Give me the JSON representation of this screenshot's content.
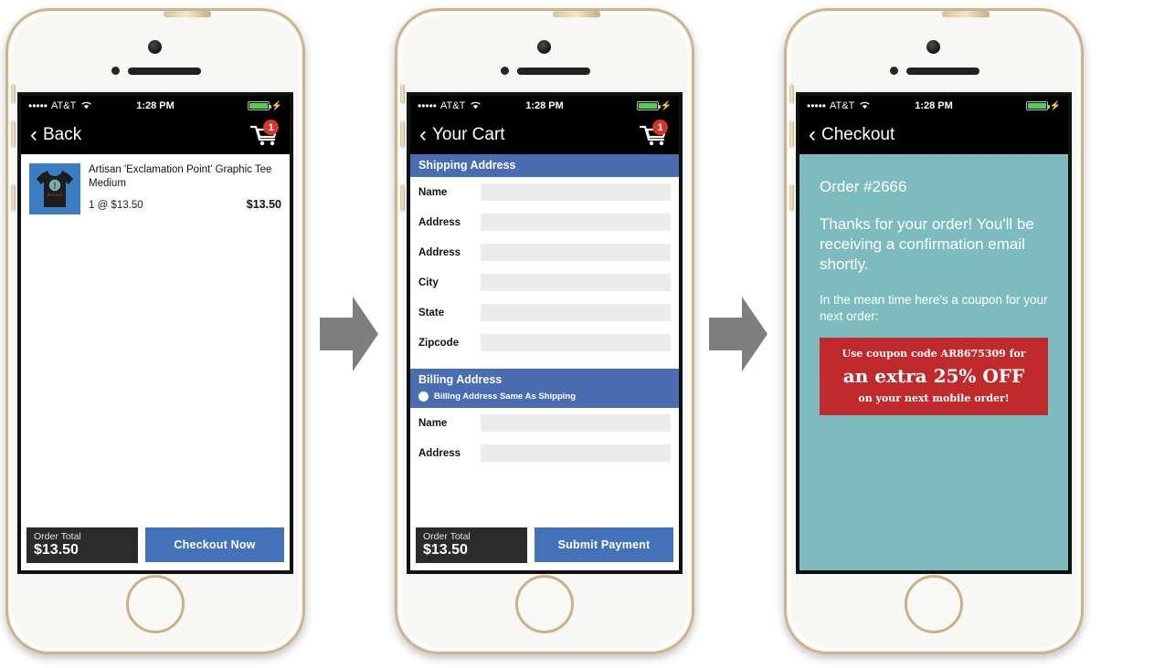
{
  "meta": {
    "screens": 3,
    "arrow_color": "#7f7f7f",
    "accent_blue": "#4a6cb0",
    "accent_teal": "#7cbcbf",
    "accent_red": "#c02a2c",
    "badge_red": "#d9342b"
  },
  "status_bar": {
    "signal_dots": "•••••",
    "carrier": "AT&T",
    "wifi_icon": "wifi-icon",
    "time": "1:28 PM",
    "battery_icon": "battery-icon",
    "charging_icon": "⚡"
  },
  "screen1": {
    "nav": {
      "back_icon": "‹",
      "title": "Back",
      "cart_icon": "shopping-cart-icon",
      "cart_badge": "1"
    },
    "item": {
      "thumb_alt": "t-shirt-thumbnail",
      "title": "Artisan 'Exclamation Point' Graphic Tee Medium",
      "qty_price": "1 @ $13.50",
      "line_total": "$13.50"
    },
    "footer": {
      "total_label": "Order Total",
      "total_value": "$13.50",
      "cta_label": "Checkout Now"
    }
  },
  "screen2": {
    "nav": {
      "back_icon": "‹",
      "title": "Your Cart",
      "cart_icon": "shopping-cart-icon",
      "cart_badge": "1"
    },
    "shipping": {
      "heading": "Shipping Address",
      "fields": [
        {
          "label": "Name",
          "value": "",
          "placeholder": ""
        },
        {
          "label": "Address",
          "value": "",
          "placeholder": ""
        },
        {
          "label": "Address",
          "value": "",
          "placeholder": ""
        },
        {
          "label": "City",
          "value": "",
          "placeholder": ""
        },
        {
          "label": "State",
          "value": "",
          "placeholder": ""
        },
        {
          "label": "Zipcode",
          "value": "",
          "placeholder": ""
        }
      ]
    },
    "billing": {
      "heading": "Billing Address",
      "same_as_shipping_label": "Billing Address Same As Shipping",
      "same_as_shipping_selected": true,
      "fields": [
        {
          "label": "Name",
          "value": "",
          "placeholder": ""
        },
        {
          "label": "Address",
          "value": "",
          "placeholder": ""
        }
      ]
    },
    "footer": {
      "total_label": "Order Total",
      "total_value": "$13.50",
      "cta_label": "Submit Payment"
    }
  },
  "screen3": {
    "nav": {
      "back_icon": "‹",
      "title": "Checkout"
    },
    "confirmation": {
      "order_number": "Order #2666",
      "thanks": "Thanks for your order! You'll be receiving a confirmation email shortly.",
      "meantime": "In the mean time here's a coupon for your next order:",
      "coupon": {
        "line1": "Use coupon code AR8675309 for",
        "line2": "an extra 25% OFF",
        "line3": "on your next mobile order!"
      }
    }
  }
}
